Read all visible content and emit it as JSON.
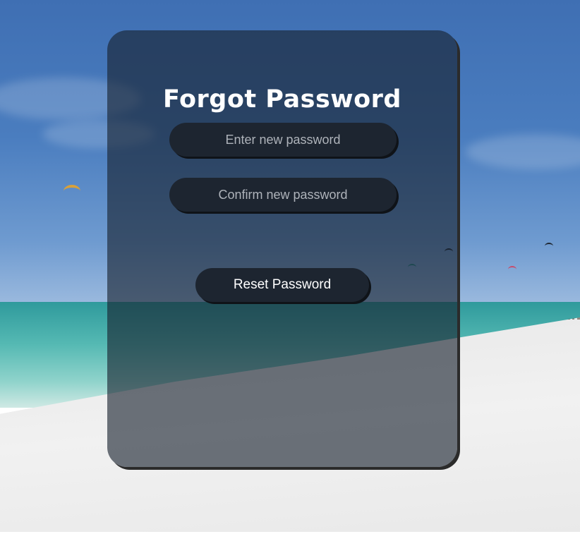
{
  "form": {
    "title": "Forgot Password",
    "new_password_placeholder": "Enter new password",
    "confirm_password_placeholder": "Confirm new password",
    "submit_label": "Reset Password"
  },
  "colors": {
    "card_background": "#16202d",
    "field_background": "#1d2530",
    "text": "#ffffff",
    "placeholder": "#aeb3ba"
  }
}
